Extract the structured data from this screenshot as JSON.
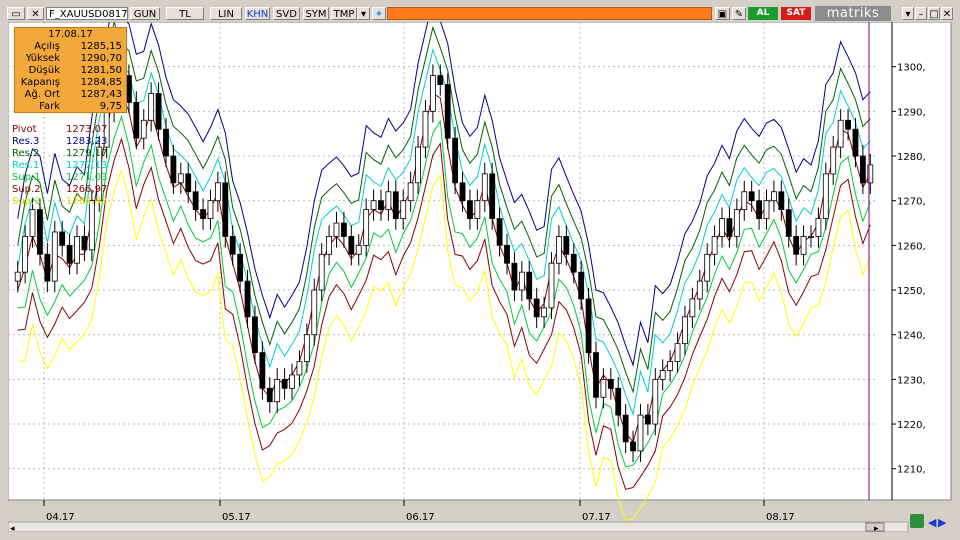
{
  "toolbar": {
    "symbol": "F_XAUUSD0817",
    "buttons": [
      "GUN",
      "TL",
      "LIN",
      "KHN",
      "SVD",
      "SYM",
      "TMP"
    ],
    "active_button": "KHN",
    "buy_label": "AL",
    "sell_label": "SAT",
    "brand": "matriks"
  },
  "info_panel": {
    "date": "17.08.17",
    "rows": [
      {
        "label": "Açılış",
        "value": "1285,15"
      },
      {
        "label": "Yüksek",
        "value": "1290,70"
      },
      {
        "label": "Düşük",
        "value": "1281,50"
      },
      {
        "label": "Kapanış",
        "value": "1284,85"
      },
      {
        "label": "Ağ. Ort",
        "value": "1287,43"
      },
      {
        "label": "Fark",
        "value": "9,75"
      }
    ]
  },
  "colors": {
    "candle_up": "#ffffff",
    "candle_down": "#000000",
    "pivot": "#8b0000",
    "res3": "#00008b",
    "res2": "#006400",
    "res1": "#00ced1",
    "sup1": "#00cc33",
    "sup2": "#8b0000",
    "sup3": "#ffff00",
    "chart_bg": "#ffffff",
    "toolbar_orange": "#ff7a1a",
    "cursor_line": "#800080"
  },
  "chart_data": {
    "type": "candlestick",
    "x_ticks": [
      "04.17",
      "05.17",
      "06.17",
      "07.17",
      "08.17"
    ],
    "ylim": [
      1203,
      1310
    ],
    "y_ticks": [
      1210,
      1220,
      1230,
      1240,
      1250,
      1260,
      1270,
      1280,
      1290,
      1300
    ],
    "grid": true,
    "legend": [
      {
        "name": "Pivot",
        "value": "1273,07",
        "color_key": "pivot"
      },
      {
        "name": "Res.3",
        "value": "1283,23",
        "color_key": "res3"
      },
      {
        "name": "Res.2",
        "value": "1279,17",
        "color_key": "res2"
      },
      {
        "name": "Res.1",
        "value": "1277,13",
        "color_key": "res1"
      },
      {
        "name": "Sup.1",
        "value": "1271,03",
        "color_key": "sup1"
      },
      {
        "name": "Sup.2",
        "value": "1266,97",
        "color_key": "sup2"
      },
      {
        "name": "Sup.3",
        "value": "1264,93",
        "color_key": "sup3"
      }
    ],
    "closes": [
      1254,
      1262,
      1268,
      1258,
      1252,
      1263,
      1260,
      1256,
      1262,
      1259,
      1270,
      1282,
      1290,
      1300,
      1298,
      1292,
      1284,
      1288,
      1294,
      1286,
      1280,
      1274,
      1276,
      1272,
      1268,
      1266,
      1270,
      1274,
      1262,
      1258,
      1252,
      1244,
      1236,
      1228,
      1225,
      1230,
      1228,
      1231,
      1234,
      1240,
      1250,
      1258,
      1262,
      1265,
      1262,
      1258,
      1260,
      1268,
      1270,
      1268,
      1272,
      1266,
      1270,
      1274,
      1282,
      1290,
      1298,
      1296,
      1284,
      1274,
      1270,
      1266,
      1270,
      1276,
      1266,
      1260,
      1256,
      1250,
      1254,
      1248,
      1244,
      1246,
      1256,
      1262,
      1258,
      1254,
      1248,
      1236,
      1226,
      1230,
      1228,
      1222,
      1216,
      1214,
      1222,
      1220,
      1230,
      1232,
      1234,
      1238,
      1244,
      1248,
      1252,
      1258,
      1262,
      1266,
      1262,
      1268,
      1272,
      1270,
      1266,
      1270,
      1272,
      1268,
      1262,
      1258,
      1262,
      1262,
      1266,
      1276,
      1282,
      1288,
      1286,
      1280,
      1274,
      1278
    ],
    "series_pivot": [
      1250,
      1255,
      1262,
      1258,
      1252,
      1258,
      1257,
      1255,
      1258,
      1258,
      1266,
      1276,
      1286,
      1294,
      1294,
      1290,
      1282,
      1285,
      1290,
      1284,
      1278,
      1273,
      1274,
      1271,
      1268,
      1266,
      1268,
      1272,
      1262,
      1256,
      1250,
      1242,
      1234,
      1228,
      1226,
      1230,
      1229,
      1231,
      1234,
      1240,
      1248,
      1256,
      1260,
      1262,
      1260,
      1257,
      1259,
      1266,
      1268,
      1267,
      1270,
      1266,
      1269,
      1272,
      1280,
      1287,
      1294,
      1293,
      1282,
      1273,
      1269,
      1266,
      1268,
      1274,
      1266,
      1260,
      1256,
      1250,
      1253,
      1248,
      1245,
      1247,
      1255,
      1260,
      1257,
      1253,
      1248,
      1237,
      1228,
      1231,
      1229,
      1223,
      1218,
      1216,
      1222,
      1221,
      1229,
      1232,
      1234,
      1238,
      1243,
      1247,
      1251,
      1256,
      1260,
      1264,
      1261,
      1266,
      1270,
      1269,
      1266,
      1269,
      1271,
      1268,
      1262,
      1258,
      1261,
      1262,
      1265,
      1274,
      1279,
      1286,
      1285,
      1279,
      1273,
      1276
    ]
  }
}
